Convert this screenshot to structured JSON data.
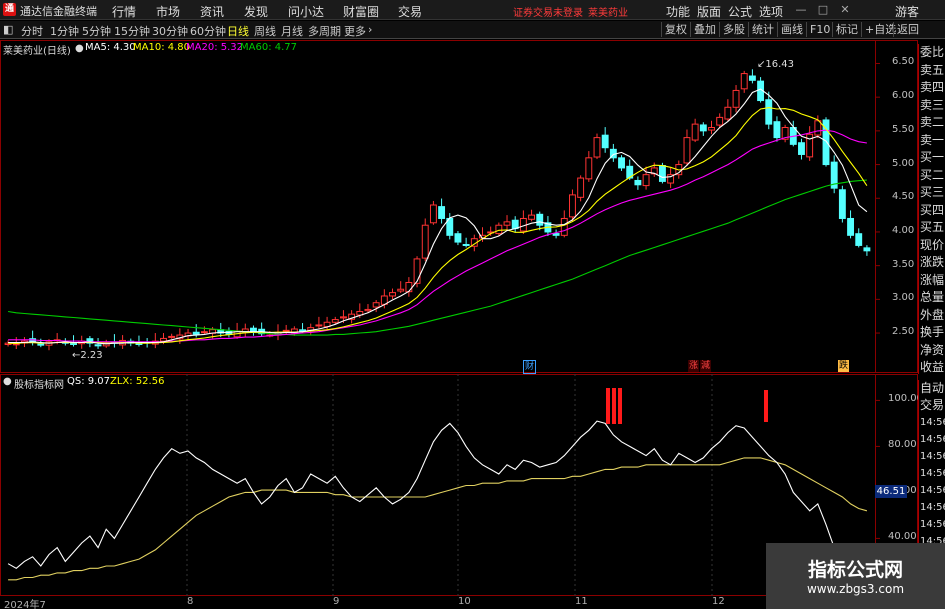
{
  "app": {
    "logo_char": "通",
    "title": "通达信金融终端",
    "menu": [
      "行情",
      "市场",
      "资讯",
      "发现",
      "问小达",
      "财富圈",
      "交易"
    ],
    "notice": "证券交易未登录",
    "stock_name_top": "莱美药业",
    "right_menu": [
      "功能",
      "版面",
      "公式",
      "选项"
    ],
    "guest": "游客",
    "window_buttons": [
      "—",
      "□",
      "✕"
    ]
  },
  "periods": {
    "tabs": [
      "分时",
      "1分钟",
      "5分钟",
      "15分钟",
      "30分钟",
      "60分钟",
      "日线",
      "周线",
      "月线",
      "多周期",
      "更多"
    ],
    "active": "日线",
    "toolbar": [
      "复权",
      "叠加",
      "多股",
      "统计",
      "画线",
      "F10",
      "标记",
      "+自选",
      "返回"
    ]
  },
  "main_chart": {
    "legend_name": "莱美药业(日线)",
    "ma5": "MA5: 4.30",
    "ma10": "MA10: 4.80",
    "ma20": "MA20: 5.32",
    "ma60": "MA60: 4.77",
    "high_label": "16.43",
    "low_label": "2.23",
    "badges": [
      "财",
      "涨",
      "跌"
    ],
    "colors": {
      "ma5": "#ffffff",
      "ma10": "#ffff00",
      "ma20": "#ff00ff",
      "ma60": "#00cc00",
      "up": "#ff3333",
      "down": "#54ffff"
    }
  },
  "right_panel": {
    "items": [
      "委比",
      "卖五",
      "卖四",
      "卖三",
      "卖二",
      "卖一",
      "买一",
      "买二",
      "买三",
      "买四",
      "买五",
      "现价",
      "涨跌",
      "涨幅",
      "总量",
      "外盘",
      "换手",
      "净资",
      "收益"
    ],
    "sub_items": [
      "自动",
      "交易",
      "14:56",
      "14:56",
      "14:56",
      "14:56",
      "14:56",
      "14:56",
      "14:56",
      "14:56",
      "14:5"
    ]
  },
  "sub_chart": {
    "legend_name": "股标指标网",
    "qs": "QS: 9.07",
    "zlx": "ZLX: 52.56",
    "qs_box": "46.51"
  },
  "dates": [
    "2024年7",
    "8",
    "9",
    "10",
    "11",
    "12"
  ],
  "watermark": {
    "title": "指标公式网",
    "url": "www.zbgs3.com"
  },
  "chart_data": [
    {
      "type": "candlestick",
      "title": "莱美药业(日线)",
      "yticks": [
        6.5,
        6.0,
        5.5,
        5.0,
        4.5,
        4.0,
        3.5,
        3.0,
        2.5
      ],
      "ylim": [
        2.1,
        6.7
      ],
      "high": 6.43,
      "low": 2.23,
      "series": [
        {
          "name": "MA5",
          "value": 4.3
        },
        {
          "name": "MA10",
          "value": 4.8
        },
        {
          "name": "MA20",
          "value": 5.32
        },
        {
          "name": "MA60",
          "value": 4.77
        }
      ],
      "closes": [
        2.35,
        2.34,
        2.38,
        2.36,
        2.32,
        2.37,
        2.4,
        2.36,
        2.33,
        2.38,
        2.35,
        2.31,
        2.34,
        2.36,
        2.39,
        2.35,
        2.33,
        2.36,
        2.38,
        2.42,
        2.45,
        2.47,
        2.5,
        2.48,
        2.52,
        2.55,
        2.5,
        2.48,
        2.53,
        2.56,
        2.52,
        2.49,
        2.47,
        2.51,
        2.54,
        2.56,
        2.53,
        2.58,
        2.62,
        2.66,
        2.7,
        2.74,
        2.78,
        2.82,
        2.85,
        2.95,
        3.05,
        3.1,
        3.15,
        3.25,
        3.6,
        4.1,
        4.4,
        4.2,
        3.95,
        3.85,
        3.8,
        3.9,
        3.95,
        4.0,
        4.1,
        4.15,
        4.05,
        4.2,
        4.25,
        4.1,
        4.0,
        3.95,
        4.2,
        4.55,
        4.8,
        5.1,
        5.4,
        5.25,
        5.1,
        4.95,
        4.8,
        4.7,
        4.85,
        4.95,
        4.75,
        4.85,
        5.0,
        5.4,
        5.6,
        5.5,
        5.55,
        5.7,
        5.85,
        6.1,
        6.35,
        6.25,
        5.95,
        5.6,
        5.4,
        5.55,
        5.3,
        5.15,
        5.45,
        5.65,
        5.0,
        4.65,
        4.2,
        3.95,
        3.8,
        3.72
      ],
      "ma5": [
        2.36,
        2.36,
        2.36,
        2.37,
        2.36,
        2.35,
        2.36,
        2.37,
        2.36,
        2.36,
        2.37,
        2.35,
        2.34,
        2.35,
        2.35,
        2.36,
        2.36,
        2.36,
        2.36,
        2.37,
        2.4,
        2.43,
        2.46,
        2.47,
        2.48,
        2.5,
        2.51,
        2.51,
        2.52,
        2.52,
        2.52,
        2.52,
        2.51,
        2.5,
        2.51,
        2.51,
        2.52,
        2.54,
        2.56,
        2.59,
        2.63,
        2.68,
        2.72,
        2.76,
        2.8,
        2.86,
        2.92,
        2.99,
        3.05,
        3.12,
        3.27,
        3.53,
        3.82,
        4.05,
        4.21,
        4.25,
        4.21,
        4.09,
        3.9,
        3.9,
        3.94,
        4.02,
        4.05,
        4.09,
        4.13,
        4.15,
        4.12,
        4.1,
        4.11,
        4.18,
        4.31,
        4.51,
        4.79,
        5.02,
        5.15,
        5.18,
        5.12,
        4.99,
        4.89,
        4.87,
        4.81,
        4.82,
        4.88,
        4.99,
        5.12,
        5.27,
        5.42,
        5.55,
        5.64,
        5.75,
        5.9,
        6.07,
        6.12,
        6.03,
        5.91,
        5.71,
        5.56,
        5.42,
        5.38,
        5.42,
        5.35,
        5.18,
        4.99,
        4.7,
        4.4,
        4.3
      ],
      "ma20": [
        2.4,
        2.4,
        2.4,
        2.4,
        2.39,
        2.39,
        2.39,
        2.38,
        2.38,
        2.38,
        2.37,
        2.37,
        2.37,
        2.37,
        2.37,
        2.37,
        2.37,
        2.37,
        2.37,
        2.37,
        2.38,
        2.38,
        2.39,
        2.4,
        2.4,
        2.41,
        2.42,
        2.42,
        2.43,
        2.44,
        2.44,
        2.45,
        2.46,
        2.47,
        2.48,
        2.49,
        2.5,
        2.51,
        2.52,
        2.54,
        2.56,
        2.58,
        2.6,
        2.62,
        2.65,
        2.68,
        2.72,
        2.76,
        2.8,
        2.85,
        2.92,
        3.02,
        3.12,
        3.2,
        3.28,
        3.35,
        3.42,
        3.48,
        3.54,
        3.6,
        3.66,
        3.72,
        3.77,
        3.82,
        3.87,
        3.92,
        3.96,
        3.99,
        4.02,
        4.07,
        4.13,
        4.2,
        4.27,
        4.33,
        4.38,
        4.43,
        4.47,
        4.5,
        4.53,
        4.56,
        4.59,
        4.62,
        4.66,
        4.71,
        4.77,
        4.82,
        4.88,
        4.94,
        5.0,
        5.07,
        5.15,
        5.23,
        5.28,
        5.32,
        5.36,
        5.4,
        5.42,
        5.44,
        5.47,
        5.5,
        5.51,
        5.49,
        5.44,
        5.38,
        5.34,
        5.32
      ],
      "ma60": [
        2.82,
        2.8,
        2.79,
        2.78,
        2.77,
        2.76,
        2.75,
        2.74,
        2.73,
        2.72,
        2.71,
        2.7,
        2.69,
        2.68,
        2.67,
        2.66,
        2.65,
        2.64,
        2.63,
        2.62,
        2.61,
        2.6,
        2.59,
        2.58,
        2.57,
        2.56,
        2.55,
        2.54,
        2.53,
        2.52,
        2.51,
        2.5,
        2.49,
        2.48,
        2.48,
        2.47,
        2.47,
        2.47,
        2.47,
        2.47,
        2.48,
        2.48,
        2.49,
        2.5,
        2.51,
        2.52,
        2.54,
        2.56,
        2.58,
        2.6,
        2.63,
        2.66,
        2.69,
        2.72,
        2.75,
        2.78,
        2.81,
        2.84,
        2.87,
        2.9,
        2.94,
        2.98,
        3.02,
        3.06,
        3.1,
        3.14,
        3.18,
        3.22,
        3.26,
        3.3,
        3.35,
        3.4,
        3.45,
        3.5,
        3.55,
        3.6,
        3.65,
        3.69,
        3.73,
        3.77,
        3.81,
        3.85,
        3.89,
        3.93,
        3.97,
        4.01,
        4.05,
        4.09,
        4.13,
        4.18,
        4.23,
        4.28,
        4.33,
        4.38,
        4.43,
        4.48,
        4.52,
        4.56,
        4.6,
        4.64,
        4.68,
        4.71,
        4.73,
        4.75,
        4.76,
        4.77
      ]
    },
    {
      "type": "line",
      "title": "股标指标网",
      "yticks": [
        100.0,
        80.0,
        60.0,
        40.0
      ],
      "ylim": [
        18,
        108
      ],
      "series": [
        {
          "name": "QS",
          "values": [
            29,
            27,
            30,
            32,
            28,
            33,
            36,
            30,
            34,
            38,
            41,
            36,
            44,
            40,
            46,
            52,
            58,
            64,
            70,
            75,
            79,
            77,
            78,
            75,
            73,
            70,
            68,
            66,
            64,
            66,
            60,
            55,
            58,
            63,
            66,
            60,
            62,
            68,
            66,
            64,
            67,
            62,
            58,
            56,
            59,
            62,
            58,
            55,
            57,
            60,
            66,
            74,
            82,
            87,
            90,
            86,
            80,
            75,
            72,
            70,
            68,
            72,
            70,
            74,
            73,
            71,
            72,
            73,
            76,
            80,
            84,
            87,
            91,
            90,
            85,
            82,
            80,
            78,
            76,
            79,
            74,
            72,
            77,
            75,
            73,
            75,
            79,
            82,
            86,
            89,
            88,
            84,
            80,
            76,
            73,
            68,
            60,
            56,
            52,
            55,
            46,
            36,
            28,
            22,
            18,
            16
          ]
        },
        {
          "name": "ZLX",
          "values": [
            22,
            22,
            23,
            23,
            24,
            24,
            25,
            25,
            26,
            26,
            27,
            27,
            28,
            28,
            29,
            30,
            31,
            33,
            35,
            38,
            41,
            44,
            47,
            50,
            52,
            54,
            56,
            58,
            59,
            60,
            60,
            61,
            61,
            61,
            61,
            60,
            60,
            60,
            60,
            60,
            59,
            59,
            58,
            58,
            58,
            58,
            58,
            58,
            58,
            58,
            58,
            58,
            59,
            60,
            61,
            62,
            63,
            63,
            64,
            64,
            64,
            65,
            65,
            65,
            66,
            66,
            66,
            66,
            66,
            67,
            67,
            68,
            69,
            70,
            70,
            71,
            71,
            71,
            72,
            72,
            72,
            72,
            72,
            72,
            72,
            72,
            72,
            72,
            73,
            74,
            75,
            75,
            75,
            74,
            73,
            72,
            70,
            68,
            66,
            64,
            62,
            60,
            58,
            55,
            53,
            52
          ]
        }
      ],
      "markers": [
        "red-bars"
      ]
    }
  ]
}
